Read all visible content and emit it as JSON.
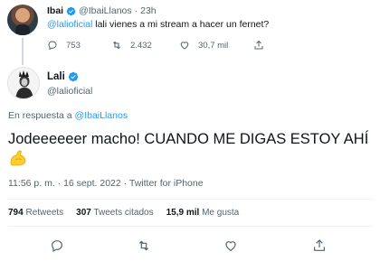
{
  "parent_tweet": {
    "display_name": "Ibai",
    "handle": "@IbaiLlanos",
    "separator": "·",
    "time": "23h",
    "mention": "@lalioficial",
    "text": " lali vienes a mi stream a hacer un fernet?",
    "replies": "753",
    "retweets": "2.432",
    "likes": "30,7 mil"
  },
  "main_tweet": {
    "display_name": "Lali",
    "handle": "@lalioficial",
    "reply_prefix": "En respuesta a ",
    "reply_to": "@IbaiLlanos",
    "text": "Jodeeeeeer macho! CUANDO ME DIGAS ESTOY AHÍ",
    "emoji": "flexed-biceps",
    "meta": "11:56 p. m. · 16 sept. 2022 · Twitter for iPhone",
    "retweets_count": "794",
    "retweets_label": "Retweets",
    "quotes_count": "307",
    "quotes_label": "Tweets citados",
    "likes_count": "15,9 mil",
    "likes_label": "Me gusta"
  },
  "icons": {
    "verified_color": "#1d9bf0",
    "action_icons": [
      "reply-icon",
      "retweet-icon",
      "like-icon",
      "share-icon"
    ]
  },
  "colors": {
    "link": "#1d9bf0",
    "secondary_text": "#536471",
    "primary_text": "#0f1419"
  }
}
